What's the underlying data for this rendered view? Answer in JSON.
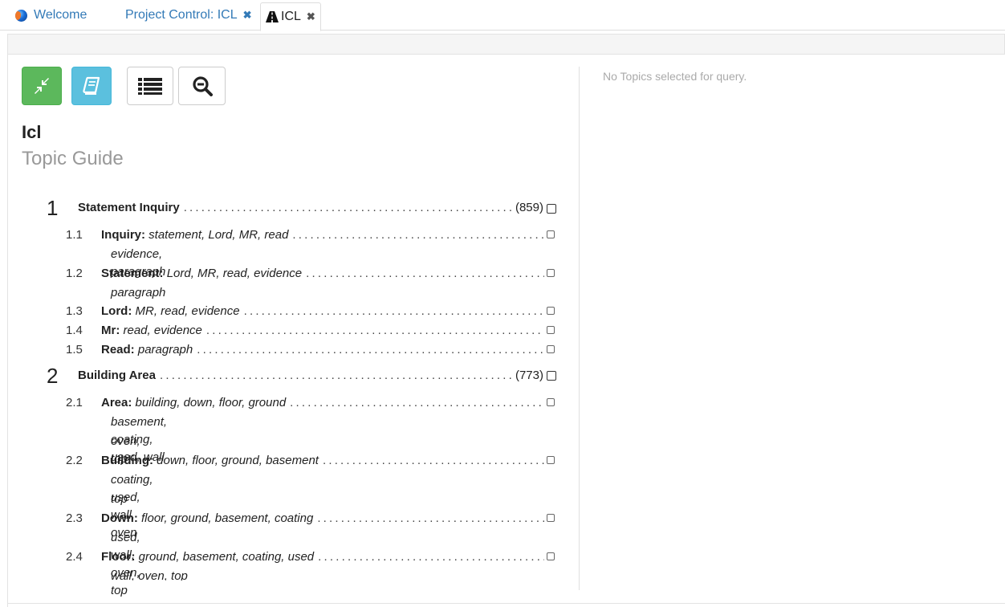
{
  "tabs": [
    {
      "label": "Welcome",
      "icon": "globe-icon",
      "closable": false
    },
    {
      "label": "Project Control: ICL",
      "closable": true
    },
    {
      "label": "ICL",
      "icon": "road-icon",
      "closable": true,
      "active": true
    }
  ],
  "close_glyph": "✖",
  "toolbar": {
    "buttons": [
      {
        "name": "compress-button",
        "icon": "compress-icon",
        "color": "#5cb85c"
      },
      {
        "name": "book-button",
        "icon": "book-icon",
        "color": "#5bc0de"
      },
      {
        "name": "list-button",
        "icon": "list-icon",
        "color": "#ffffff"
      },
      {
        "name": "zoom-out-button",
        "icon": "zoom-out-icon",
        "color": "#ffffff"
      }
    ]
  },
  "page": {
    "title": "Icl",
    "subtitle": "Topic Guide",
    "notice": "No Topics selected for query."
  },
  "topics": [
    {
      "number": "1",
      "label": "Statement Inquiry",
      "count": "(859)",
      "subtopics": [
        {
          "number": "1.1",
          "label": "Inquiry:",
          "terms": "statement, Lord, MR, read",
          "cont": [
            "evidence, paragraph"
          ]
        },
        {
          "number": "1.2",
          "label": "Statement:",
          "terms": "Lord, MR, read, evidence",
          "cont": [
            "paragraph"
          ]
        },
        {
          "number": "1.3",
          "label": "Lord:",
          "terms": "MR, read, evidence",
          "cont": []
        },
        {
          "number": "1.4",
          "label": "Mr:",
          "terms": "read, evidence",
          "cont": []
        },
        {
          "number": "1.5",
          "label": "Read:",
          "terms": "paragraph",
          "cont": []
        }
      ]
    },
    {
      "number": "2",
      "label": "Building Area",
      "count": "(773)",
      "subtopics": [
        {
          "number": "2.1",
          "label": "Area:",
          "terms": "building, down, floor, ground",
          "cont": [
            "basement, coating, used, wall",
            "oven, top"
          ]
        },
        {
          "number": "2.2",
          "label": "Building:",
          "terms": "down, floor, ground, basement",
          "cont": [
            "coating, used, wall, oven",
            "top"
          ]
        },
        {
          "number": "2.3",
          "label": "Down:",
          "terms": "floor, ground, basement, coating",
          "cont": [
            "used, wall, oven, top"
          ]
        },
        {
          "number": "2.4",
          "label": "Floor:",
          "terms": "ground, basement, coating, used",
          "cont": [
            "wall, oven, top"
          ]
        }
      ]
    }
  ]
}
